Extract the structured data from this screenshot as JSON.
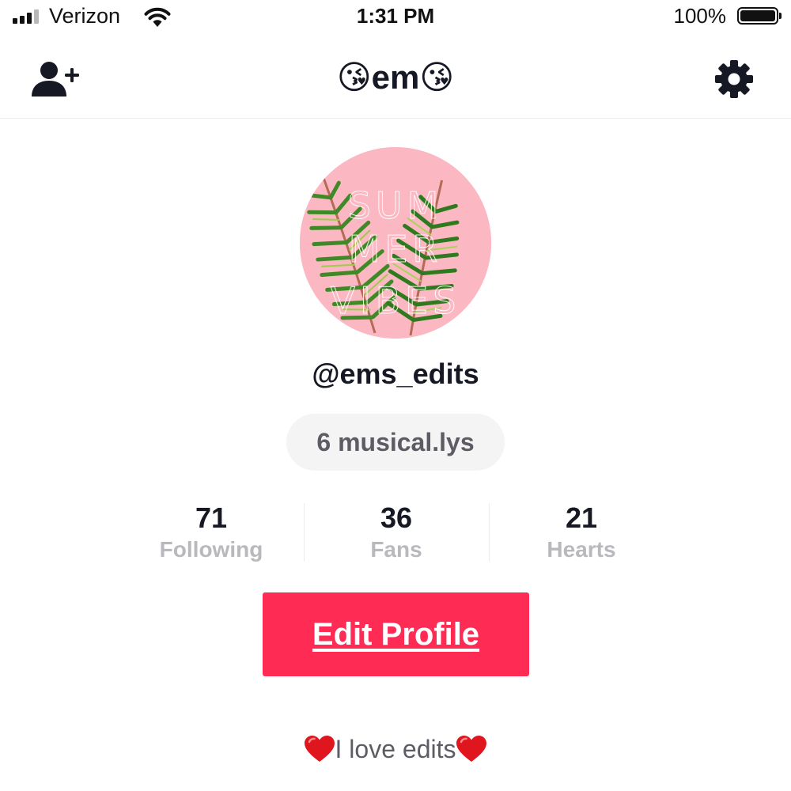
{
  "status_bar": {
    "carrier": "Verizon",
    "time": "1:31 PM",
    "battery_percent": "100%"
  },
  "nav": {
    "title": "😘em😘",
    "left_icon": "add-user-icon",
    "right_icon": "gear-icon"
  },
  "profile": {
    "avatar_text": [
      "SUM",
      "MER",
      "VIBES"
    ],
    "username": "@ems_edits",
    "musically_count": "6 musical.lys",
    "stats": [
      {
        "value": "71",
        "label": "Following"
      },
      {
        "value": "36",
        "label": "Fans"
      },
      {
        "value": "21",
        "label": "Hearts"
      }
    ],
    "edit_button": "Edit Profile",
    "bio": "I love edits"
  },
  "colors": {
    "accent": "#fe2c55",
    "avatar_bg": "#fbb8c2",
    "text_primary": "#161823",
    "text_secondary": "#b8b8bd"
  }
}
